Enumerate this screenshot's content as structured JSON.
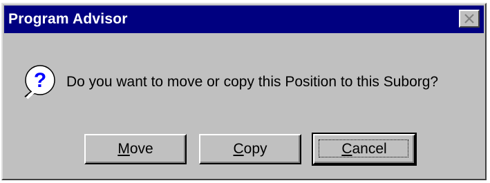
{
  "window": {
    "title": "Program Advisor",
    "close_icon": "close-icon"
  },
  "dialog": {
    "icon": "question-icon",
    "message": "Do you want to move or copy this Position to this Suborg?"
  },
  "buttons": {
    "move": {
      "mnemonic": "M",
      "rest": "ove"
    },
    "copy": {
      "mnemonic": "C",
      "rest": "opy"
    },
    "cancel": {
      "mnemonic": "C",
      "rest": "ancel"
    }
  },
  "colors": {
    "titlebar": "#000080",
    "face": "#c0c0c0",
    "icon_blue": "#0000ff"
  }
}
